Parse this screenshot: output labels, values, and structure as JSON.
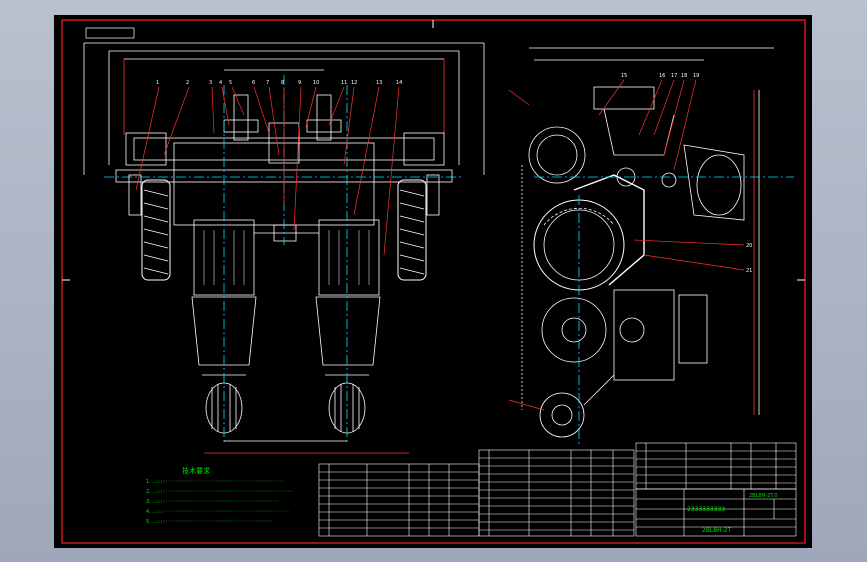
{
  "drawing": {
    "notes_heading": "技术要求",
    "notes": [
      "1. ……",
      "2. ……",
      "3. ……",
      "4. ……",
      "5. ……"
    ],
    "title_block": {
      "name": "2333333333",
      "code_left": "2BL8H-2T",
      "code_right": "2BL8H-2T.0"
    },
    "colors": {
      "frame": "#ff2020",
      "geometry": "#ffffff",
      "centerline": "#00e0ff",
      "leader": "#ff3030",
      "text": "#00e000"
    }
  }
}
